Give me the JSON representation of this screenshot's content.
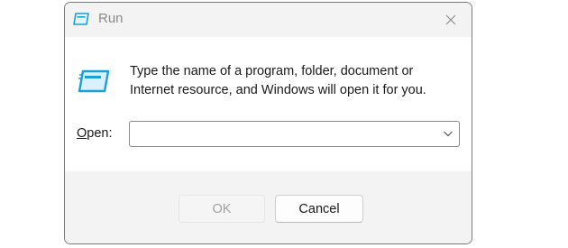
{
  "window": {
    "title": "Run",
    "app_icon": "run-app-icon",
    "close_icon": "close-icon"
  },
  "content": {
    "message": "Type the name of a program, folder, document or Internet resource, and Windows will open it for you.",
    "open_label_accel": "O",
    "open_label_rest": "pen:",
    "open_value": "",
    "dropdown_icon": "chevron-down-icon"
  },
  "buttons": {
    "ok": "OK",
    "cancel": "Cancel"
  },
  "colors": {
    "titlebar_bg": "#f3f3f3",
    "footer_bg": "#f3f3f3",
    "icon_accent": "#1a9fd6",
    "disabled_text": "#a0a0a0"
  }
}
